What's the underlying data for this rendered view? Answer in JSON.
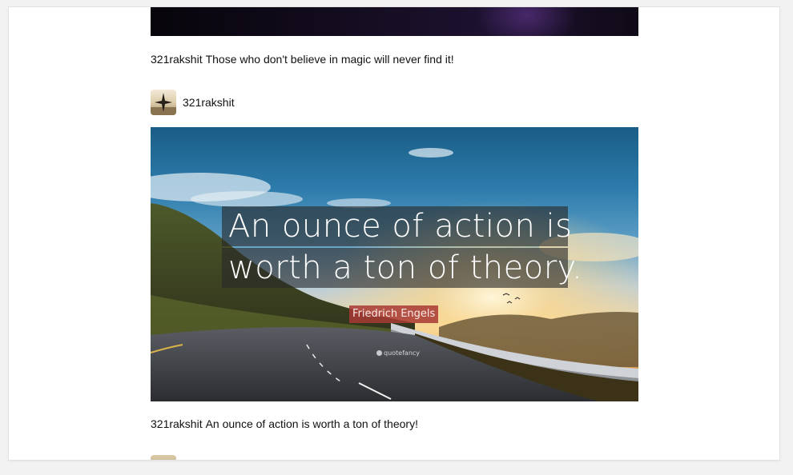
{
  "feed": {
    "previous_post": {
      "username": "321rakshit",
      "caption": "Those who don't believe in magic will never find it!"
    },
    "post": {
      "username": "321rakshit",
      "avatar_icon": "avatar-icon",
      "image": {
        "quote_line_1": "An ounce of action is",
        "quote_line_2": "worth a ton of theory.",
        "author": "Friedrich Engels",
        "watermark": "quotefancy"
      },
      "caption_user": "321rakshit",
      "caption": "An ounce of action is worth a ton of theory!"
    }
  }
}
